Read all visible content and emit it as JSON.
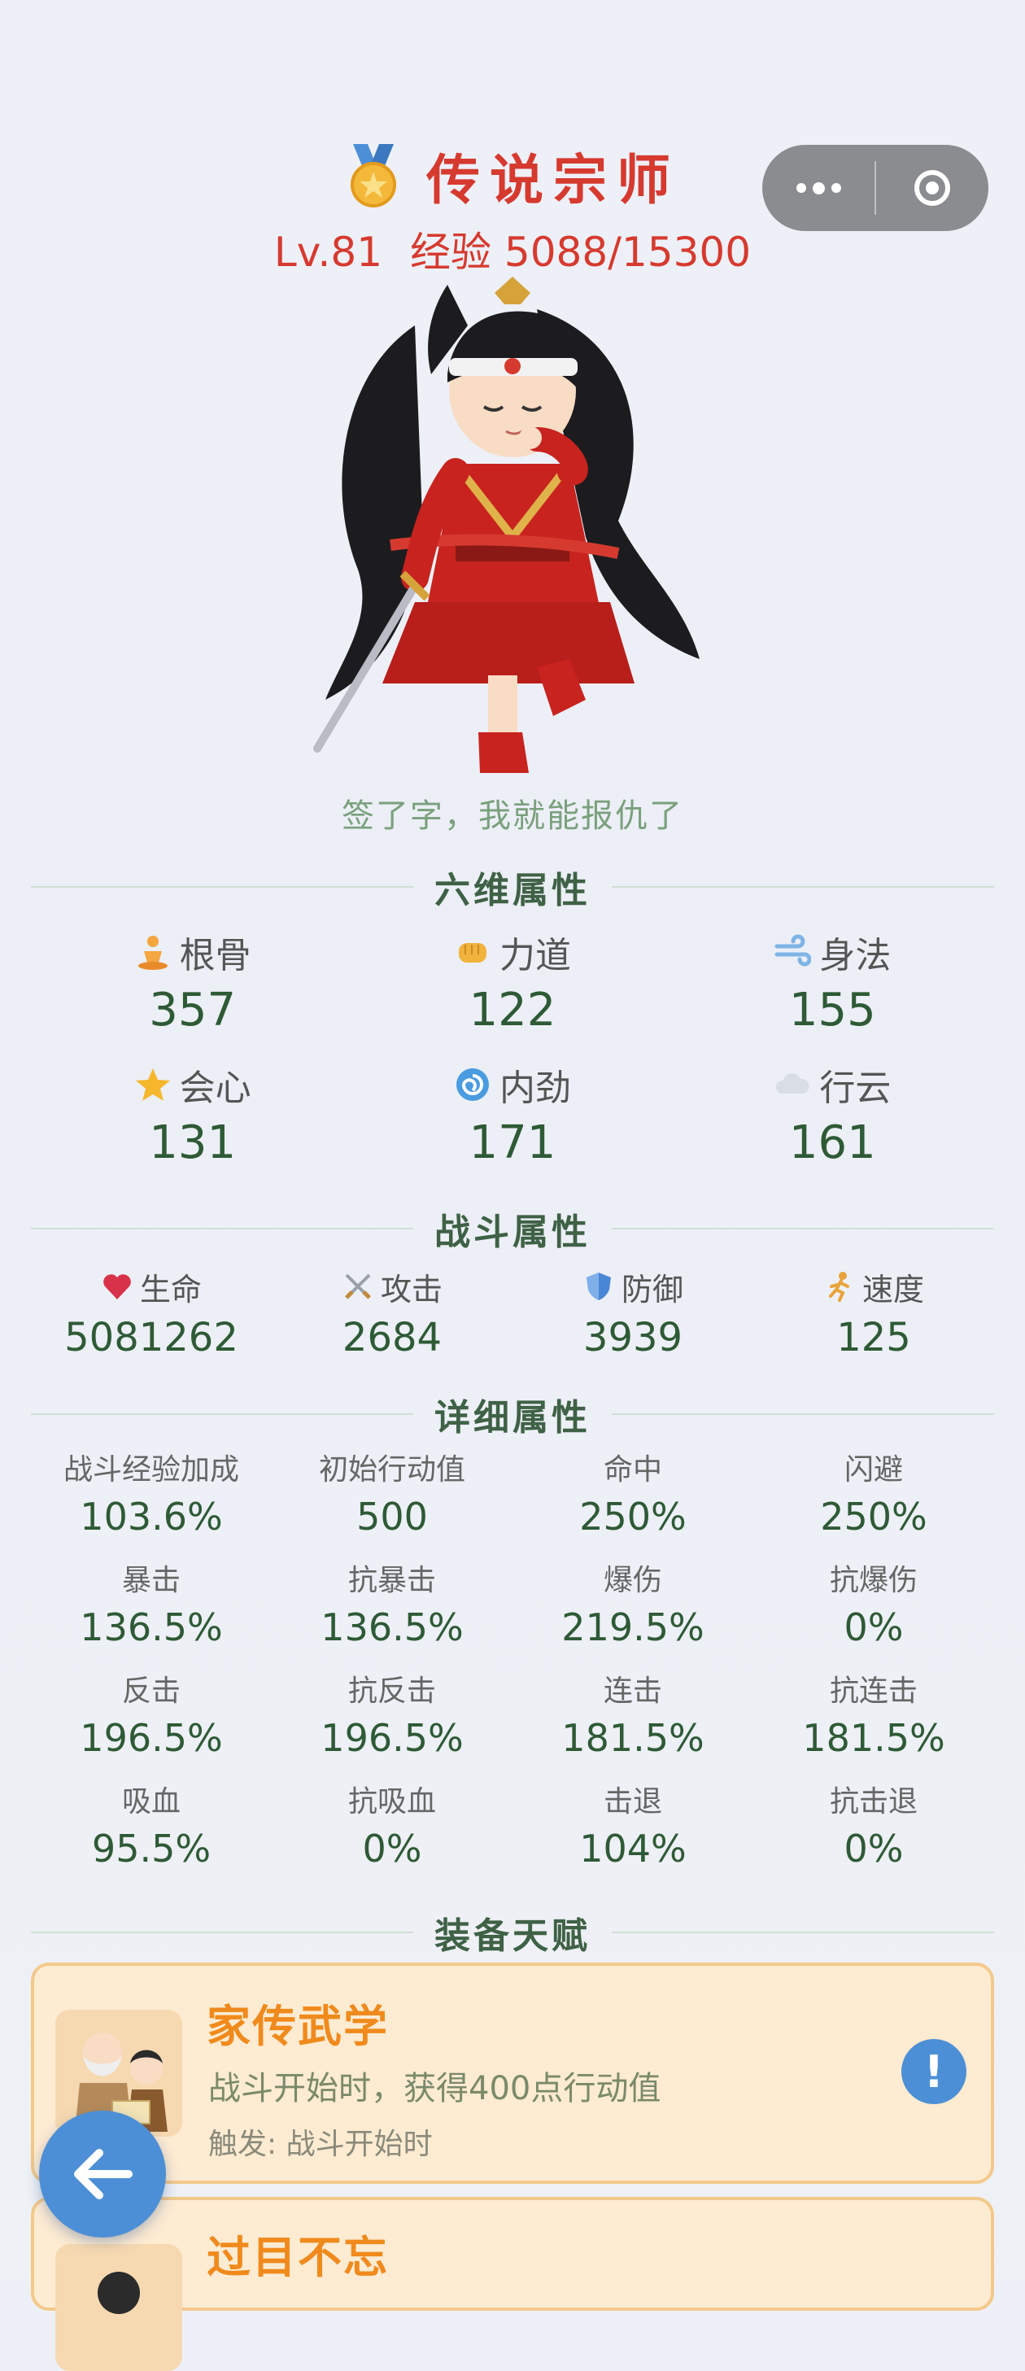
{
  "header": {
    "rank_title": "传说宗师",
    "level": "Lv.81",
    "exp": "经验 5088/15300",
    "motto": "签了字，我就能报仇了"
  },
  "sections": {
    "six": "六维属性",
    "combat": "战斗属性",
    "detail": "详细属性",
    "talent": "装备天赋"
  },
  "six_attributes": [
    {
      "name": "根骨",
      "value": "357",
      "icon": "meditation-icon"
    },
    {
      "name": "力道",
      "value": "122",
      "icon": "fist-icon"
    },
    {
      "name": "身法",
      "value": "155",
      "icon": "wind-icon"
    },
    {
      "name": "会心",
      "value": "131",
      "icon": "star-icon"
    },
    {
      "name": "内劲",
      "value": "171",
      "icon": "swirl-icon"
    },
    {
      "name": "行云",
      "value": "161",
      "icon": "cloud-icon"
    }
  ],
  "combat_attributes": [
    {
      "name": "生命",
      "value": "5081262",
      "icon": "heart-icon"
    },
    {
      "name": "攻击",
      "value": "2684",
      "icon": "crossed-swords-icon"
    },
    {
      "name": "防御",
      "value": "3939",
      "icon": "shield-icon"
    },
    {
      "name": "速度",
      "value": "125",
      "icon": "runner-icon"
    }
  ],
  "detail_attributes": [
    {
      "name": "战斗经验加成",
      "value": "103.6%"
    },
    {
      "name": "初始行动值",
      "value": "500"
    },
    {
      "name": "命中",
      "value": "250%"
    },
    {
      "name": "闪避",
      "value": "250%"
    },
    {
      "name": "暴击",
      "value": "136.5%"
    },
    {
      "name": "抗暴击",
      "value": "136.5%"
    },
    {
      "name": "爆伤",
      "value": "219.5%"
    },
    {
      "name": "抗爆伤",
      "value": "0%"
    },
    {
      "name": "反击",
      "value": "196.5%"
    },
    {
      "name": "抗反击",
      "value": "196.5%"
    },
    {
      "name": "连击",
      "value": "181.5%"
    },
    {
      "name": "抗连击",
      "value": "181.5%"
    },
    {
      "name": "吸血",
      "value": "95.5%"
    },
    {
      "name": "抗吸血",
      "value": "0%"
    },
    {
      "name": "击退",
      "value": "104%"
    },
    {
      "name": "抗击退",
      "value": "0%"
    }
  ],
  "talents": [
    {
      "name": "家传武学",
      "desc": "战斗开始时，获得400点行动值",
      "trigger": "触发: 战斗开始时",
      "info_label": "!"
    },
    {
      "name": "过目不忘"
    }
  ],
  "colors": {
    "title_red": "#d63a2f",
    "value_green": "#2e5a36",
    "talent_orange": "#f08a1c",
    "talent_bg": "#fdebd2",
    "button_blue": "#4d8fd6"
  }
}
